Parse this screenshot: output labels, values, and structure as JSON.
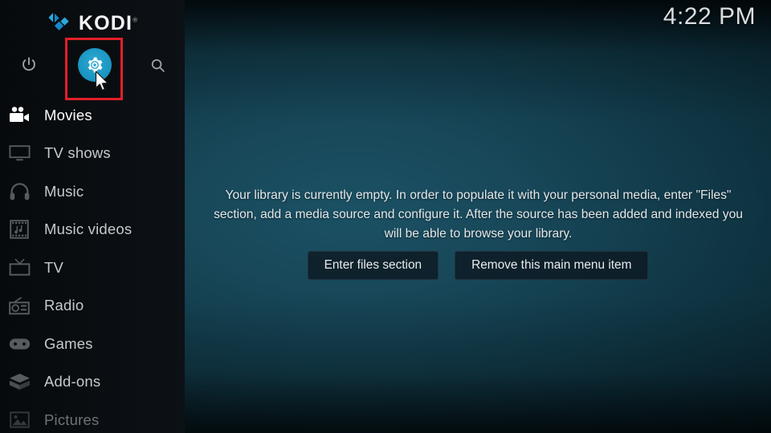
{
  "app": {
    "name": "KODI",
    "trademark": "®",
    "logo_icon": "kodi-logo-icon",
    "accent_color": "#1b96c2",
    "highlight_color": "#e21f28"
  },
  "header": {
    "clock": "4:22 PM"
  },
  "sidebar": {
    "top_actions": [
      {
        "name": "power",
        "icon": "power-icon",
        "label": "Power"
      },
      {
        "name": "settings",
        "icon": "gear-icon",
        "label": "Settings",
        "highlighted": true
      },
      {
        "name": "search",
        "icon": "search-icon",
        "label": "Search"
      }
    ],
    "items": [
      {
        "label": "Movies",
        "icon": "movie-camera-icon",
        "state": "selected"
      },
      {
        "label": "TV shows",
        "icon": "television-icon",
        "state": "normal"
      },
      {
        "label": "Music",
        "icon": "headphones-icon",
        "state": "normal"
      },
      {
        "label": "Music videos",
        "icon": "film-music-icon",
        "state": "normal"
      },
      {
        "label": "TV",
        "icon": "tv-antenna-icon",
        "state": "normal"
      },
      {
        "label": "Radio",
        "icon": "radio-icon",
        "state": "normal"
      },
      {
        "label": "Games",
        "icon": "gamepad-icon",
        "state": "normal"
      },
      {
        "label": "Add-ons",
        "icon": "open-box-icon",
        "state": "normal"
      },
      {
        "label": "Pictures",
        "icon": "picture-icon",
        "state": "dim"
      }
    ]
  },
  "main": {
    "empty_message": "Your library is currently empty. In order to populate it with your personal media, enter \"Files\" section, add a media source and configure it. After the source has been added and indexed you will be able to browse your library.",
    "buttons": [
      {
        "label": "Enter files section"
      },
      {
        "label": "Remove this main menu item"
      }
    ]
  }
}
